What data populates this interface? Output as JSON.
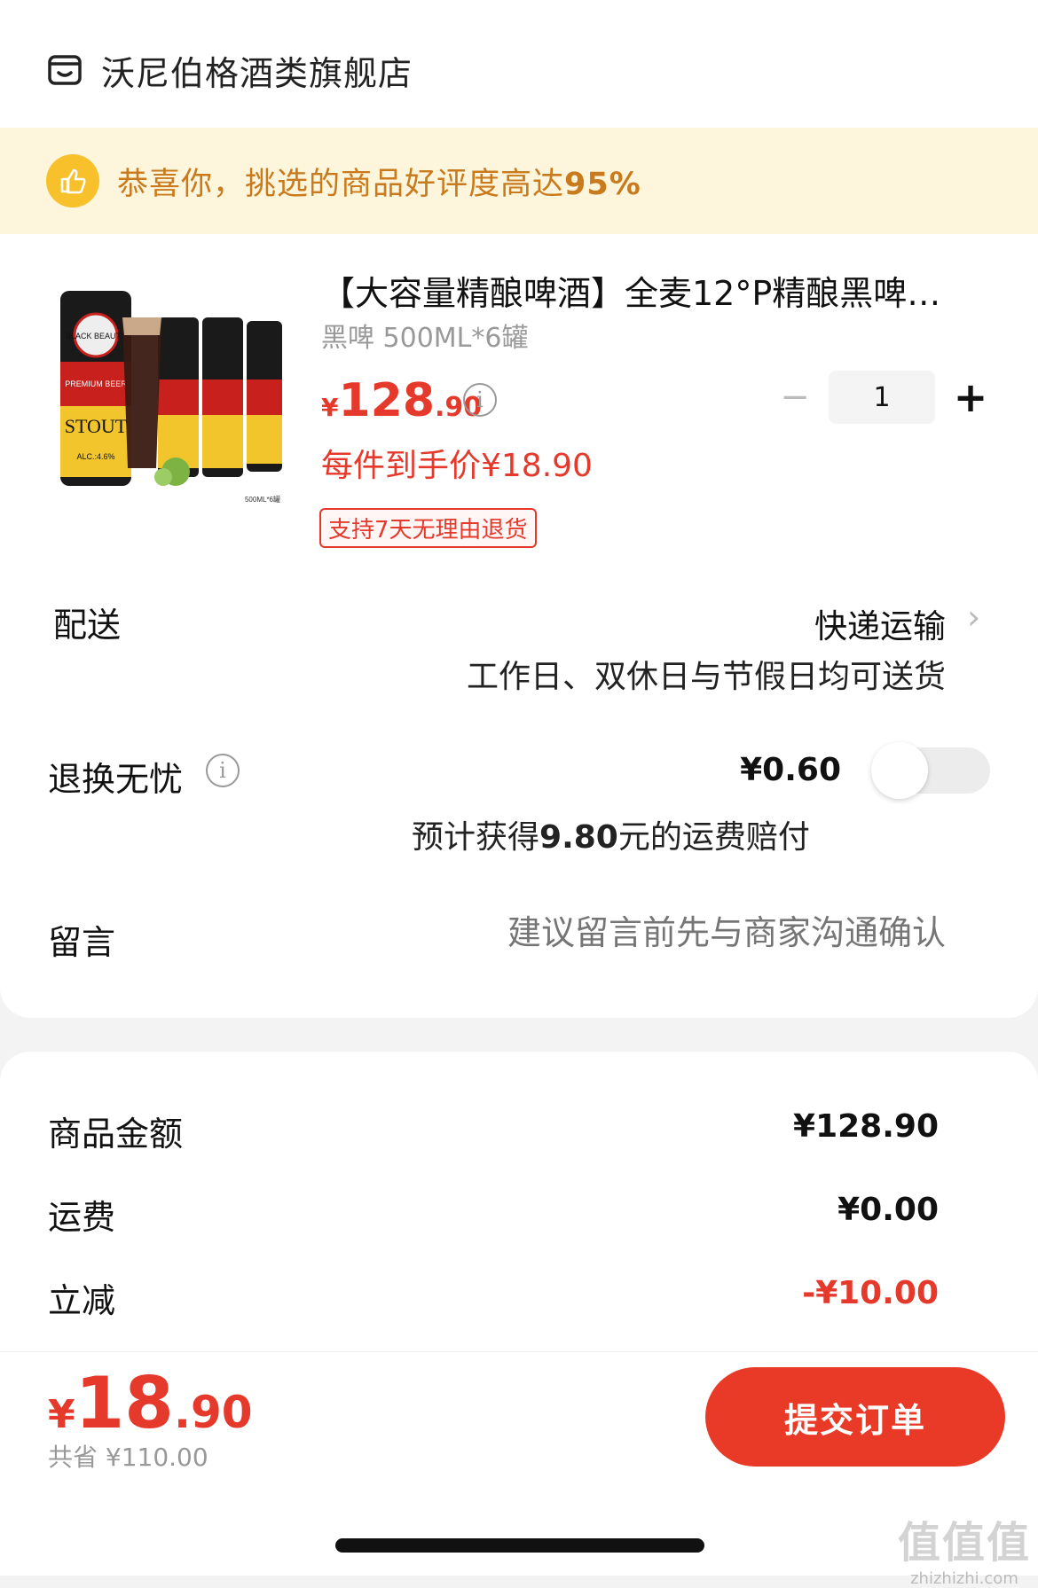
{
  "store": {
    "name": "沃尼伯格酒类旗舰店",
    "icon": "shop-icon"
  },
  "banner": {
    "text": "恭喜你，挑选的商品好评度高达",
    "highlight": "95%",
    "icon": "thumbs-up-icon"
  },
  "product": {
    "title": "【大容量精酿啤酒】全麦12°P精酿黑啤…",
    "spec": "黑啤 500ML*6罐",
    "price_symbol": "¥",
    "price_int": "128",
    "price_dec": ".90",
    "unit_price": "每件到手价¥18.90",
    "tag": "支持7天无理由退货",
    "quantity": "1",
    "image_texts": {
      "brand": "BLACK BEAUTY",
      "premium": "PREMIUM BEER",
      "stout": "STOUT",
      "alc": "ALC.:4.6%",
      "pack": "500ML*6罐"
    }
  },
  "delivery": {
    "label": "配送",
    "value": "快递运输",
    "note": "工作日、双休日与节假日均可送货"
  },
  "return_insurance": {
    "label": "退换无忧",
    "price": "¥0.60",
    "note_prefix": "预计获得",
    "note_amount": "9.80",
    "note_suffix": "元的运费赔付",
    "enabled": false
  },
  "message": {
    "label": "留言",
    "placeholder": "建议留言前先与商家沟通确认"
  },
  "summary": {
    "items": [
      {
        "label": "商品金额",
        "value": "¥128.90"
      },
      {
        "label": "运费",
        "value": "¥0.00"
      },
      {
        "label": "立减",
        "value": "-¥10.00"
      }
    ]
  },
  "footer": {
    "total_symbol": "¥",
    "total_int": "18",
    "total_dec": ".90",
    "saved": "共省 ¥110.00",
    "submit_label": "提交订单"
  },
  "watermark": {
    "big": "值值值",
    "small": "zhizhizhi.com"
  },
  "colors": {
    "accent": "#e4392b",
    "banner_bg": "#fdf6dd",
    "banner_text": "#c97a1c"
  }
}
